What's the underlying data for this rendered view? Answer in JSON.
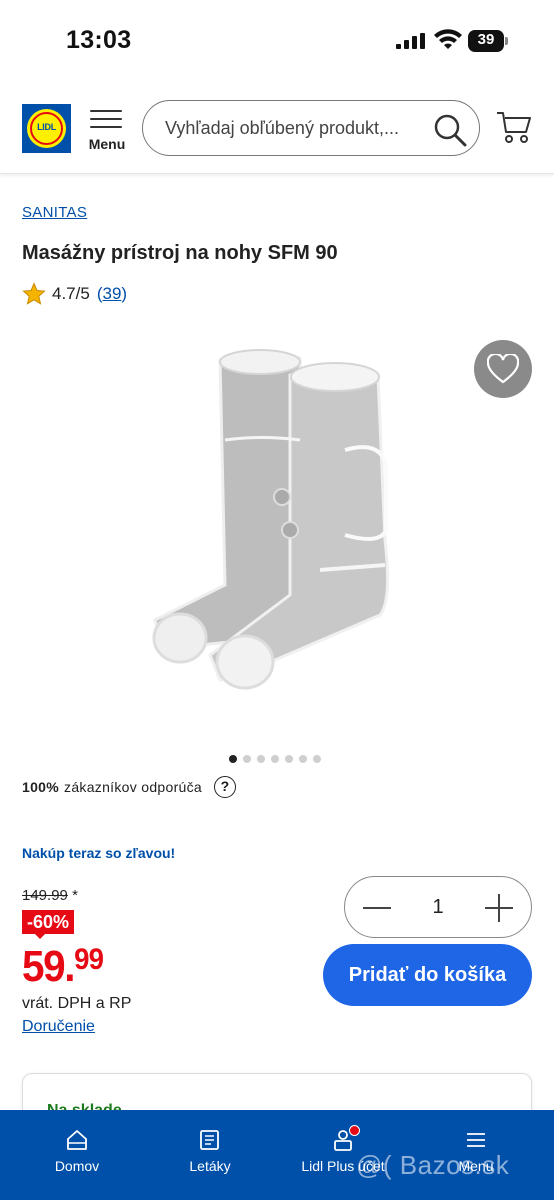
{
  "status_bar": {
    "time": "13:03",
    "battery": "39"
  },
  "header": {
    "logo_text": "LIDL",
    "menu_label": "Menu",
    "search_placeholder": "Vyhľadaj obľúbený produkt,..."
  },
  "product": {
    "brand": "SANITAS",
    "title": "Masážny prístroj na nohy SFM 90",
    "rating_value": "4.7/5",
    "rating_count": "39",
    "image_count": 7,
    "active_image": 1
  },
  "recommendation": {
    "percent": "100%",
    "text": "zákazníkov odporúča",
    "help": "?"
  },
  "pricing": {
    "promo_text": "Nakúp teraz so zľavou!",
    "old_price": "149.99",
    "old_price_mark": "*",
    "discount": "-60%",
    "price_main": "59.",
    "price_cents": "99",
    "vat_text": "vrát. DPH a RP",
    "delivery_link": "Doručenie"
  },
  "quantity": {
    "value": "1"
  },
  "add_to_cart": "Pridať do košíka",
  "stock": {
    "text": "Na sklade"
  },
  "bottom_nav": [
    {
      "label": "Domov"
    },
    {
      "label": "Letáky"
    },
    {
      "label": "Lidl Plus účet"
    },
    {
      "label": "Menu"
    }
  ],
  "watermark": "@( Bazos.sk",
  "colors": {
    "brand_blue": "#0050aa",
    "price_red": "#e60a14",
    "button_blue": "#1f66e6",
    "logo_yellow": "#fff000"
  }
}
